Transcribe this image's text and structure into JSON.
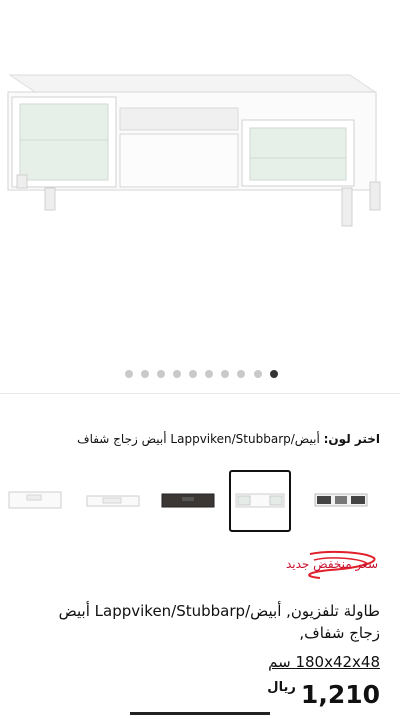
{
  "colors": {
    "accent": "#c8102e",
    "dot_active": "#333333",
    "dot_inactive": "#c9c9c9"
  },
  "gallery": {
    "image_icon": "tv-bench-image",
    "dot_count": 10,
    "active_dot": 10
  },
  "color_selector": {
    "label": "اختر لون:",
    "value": "أبيض/Lappviken/Stubbarp أبيض زجاج شفاف",
    "swatches": [
      {
        "name": "white-plain",
        "selected": false
      },
      {
        "name": "white-low",
        "selected": false
      },
      {
        "name": "black-brown",
        "selected": false
      },
      {
        "name": "white-glass",
        "selected": true
      },
      {
        "name": "white-black-glass",
        "selected": false
      }
    ]
  },
  "product": {
    "badge": "سعر منخفض جديد",
    "description": "طاولة تلفزيون, أبيض/Lappviken/Stubbarp أبيض زجاج شفاف,",
    "dimensions": "180x42x48 سم",
    "price": "1,210",
    "currency": "ريال"
  }
}
